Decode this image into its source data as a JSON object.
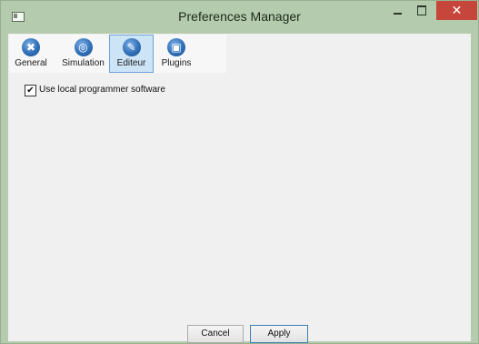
{
  "window": {
    "title": "Preferences Manager",
    "close_glyph": "✕"
  },
  "toolbar": {
    "items": [
      {
        "label": "General",
        "icon": "tools-icon",
        "glyph": "✖",
        "active": false
      },
      {
        "label": "Simulation",
        "icon": "simulation-icon",
        "glyph": "◎",
        "active": false
      },
      {
        "label": "Editeur",
        "icon": "editor-icon",
        "glyph": "✎",
        "active": true
      },
      {
        "label": "Plugins",
        "icon": "plugins-icon",
        "glyph": "▣",
        "active": false
      }
    ]
  },
  "options": {
    "use_local_programmer": {
      "label": "Use local programmer software",
      "checked": true,
      "check_glyph": "✔"
    }
  },
  "footer": {
    "cancel_label": "Cancel",
    "apply_label": "Apply"
  },
  "colors": {
    "frame": "#b4ccad",
    "close_button": "#c7463c",
    "active_tab": "#cde4f7",
    "active_tab_border": "#6ea2d8"
  }
}
